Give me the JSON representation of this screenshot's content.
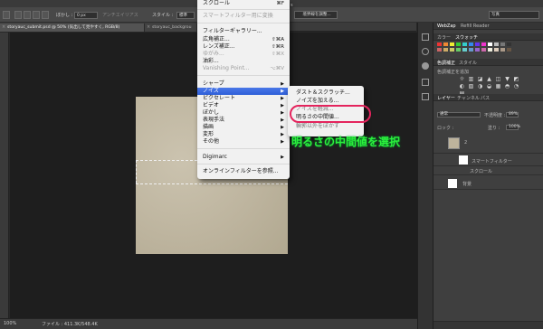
{
  "options_bar": {
    "feather_label": "ぼかし :",
    "feather_value": "0 px",
    "antialias_label": "アンチエイリアス",
    "style_label": "スタイル :",
    "style_value": "標準",
    "refine_edge_label": "境界線を調整...",
    "workspace_value": "写真",
    "trailing_char": "s"
  },
  "tabs": [
    {
      "label": "storyauc_submit.psd @ 50% (気出して見やすく, RGB/8)"
    },
    {
      "label": "storyauc_backgrou"
    }
  ],
  "filter_menu": {
    "items": [
      {
        "label": "スクロール",
        "shortcut": "⌘F"
      },
      {
        "label": "スマートフィルター用に変換",
        "disabled": true
      },
      {
        "label": "フィルターギャラリー..."
      },
      {
        "label": "広角補正...",
        "shortcut": "⇧⌘A"
      },
      {
        "label": "レンズ補正...",
        "shortcut": "⇧⌘R"
      },
      {
        "label": "ゆがみ...",
        "shortcut": "⇧⌘X",
        "disabled": true
      },
      {
        "label": "油彩..."
      },
      {
        "label": "Vanishing Point...",
        "shortcut": "⌥⌘V",
        "disabled": true
      },
      {
        "label": "シャープ"
      },
      {
        "label": "ノイズ"
      },
      {
        "label": "ピクセレート"
      },
      {
        "label": "ビデオ"
      },
      {
        "label": "ぼかし"
      },
      {
        "label": "表現手法"
      },
      {
        "label": "描画"
      },
      {
        "label": "変形"
      },
      {
        "label": "その他"
      },
      {
        "label": "Digimarc"
      },
      {
        "label": "オンラインフィルターを参照..."
      }
    ]
  },
  "noise_submenu": {
    "items": [
      {
        "label": "ダスト＆スクラッチ..."
      },
      {
        "label": "ノイズを加える..."
      },
      {
        "label": "ノイズを軽減..."
      },
      {
        "label": "明るさの中間値..."
      },
      {
        "label": "輪郭以外をぼかす"
      }
    ]
  },
  "callout_text": "明るさの中間値を選択",
  "status": {
    "zoom": "100%",
    "file_info": "ファイル : 411.3K/548.4K"
  },
  "panels": {
    "top_tabs": [
      "WebZap",
      "Refill Reader"
    ],
    "color_tabs": [
      "カラー",
      "スウォッチ"
    ],
    "adjust_tabs": [
      "色調補正",
      "スタイル"
    ],
    "adjust_title": "色調補正を追加",
    "layer_tabs": [
      "レイヤー",
      "チャンネル",
      "パス"
    ],
    "blend_mode": "通常",
    "opacity_label": "不透明度 :",
    "opacity_value": "89%",
    "lock_label": "ロック :",
    "fill_label": "塗り :",
    "fill_value": "100%",
    "layers": [
      {
        "name": "2"
      },
      {
        "name": "スマートフィルター"
      },
      {
        "name": "スクロール"
      },
      {
        "name": "背景"
      }
    ]
  },
  "colors": {
    "menu_highlight": "#2f5fd8",
    "oval": "#e4245d",
    "callout": "#2cf03c"
  }
}
